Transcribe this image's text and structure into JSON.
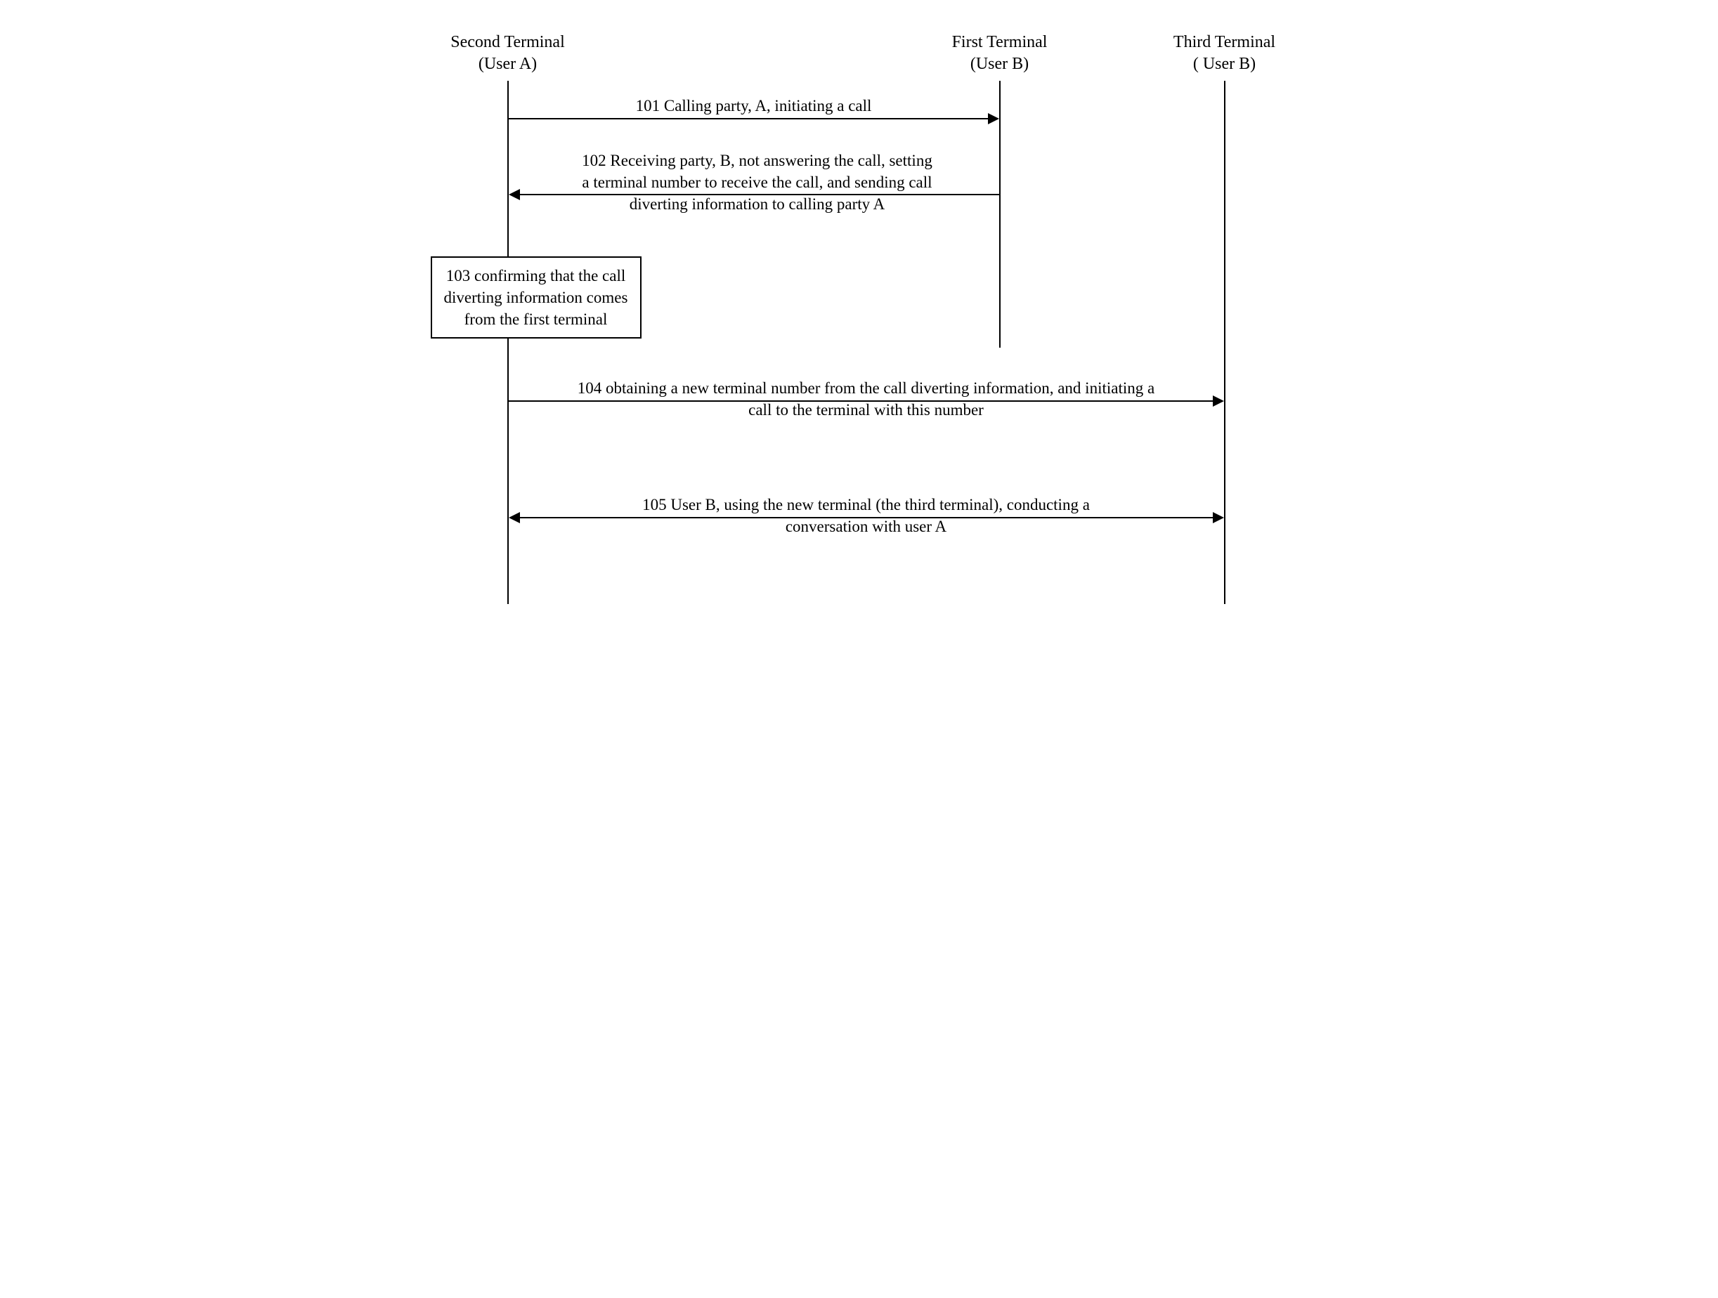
{
  "participants": {
    "second": {
      "title": "Second Terminal",
      "subtitle": "(User A)"
    },
    "first": {
      "title": "First Terminal",
      "subtitle": "(User B)"
    },
    "third": {
      "title": "Third Terminal",
      "subtitle": "( User B)"
    }
  },
  "messages": {
    "m101": "101 Calling party, A, initiating a call",
    "m102": "102 Receiving party, B, not answering the call, setting a terminal number to receive the call, and sending call diverting information to calling party A",
    "m103": "103 confirming that the call diverting information comes from the first terminal",
    "m104": "104 obtaining a new terminal number from the call diverting information, and initiating a call to the terminal with this number",
    "m105": "105 User B, using the new terminal (the third terminal), conducting a conversation with user A"
  }
}
